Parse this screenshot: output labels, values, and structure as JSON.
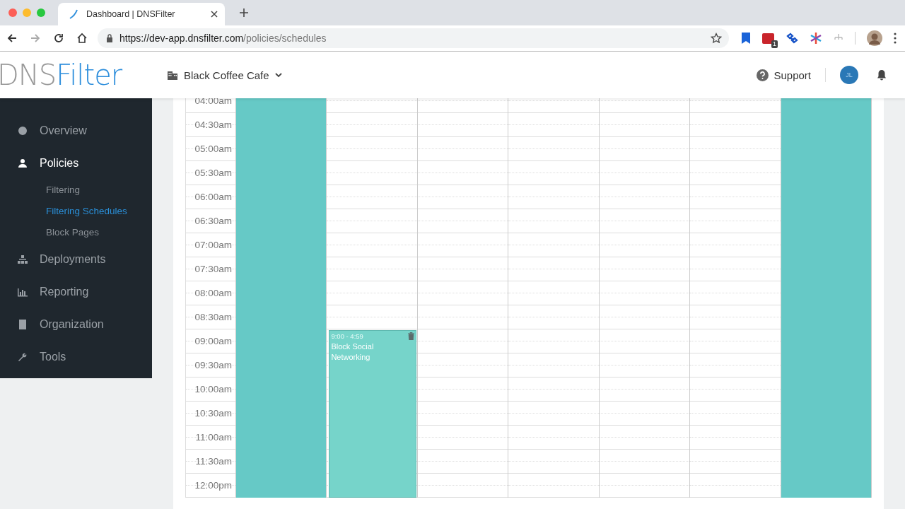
{
  "browser": {
    "tab_title": "Dashboard | DNSFilter",
    "url_host": "https://dev-app.dnsfilter.com",
    "url_path": "/policies/schedules",
    "extension_badge": "1"
  },
  "header": {
    "logo_left": "DNS",
    "logo_right": "Filter",
    "organization": "Black Coffee Cafe",
    "support": "Support",
    "avatar_initials": "JL"
  },
  "sidebar": {
    "items": [
      {
        "label": "Overview",
        "selected": false
      },
      {
        "label": "Policies",
        "selected": true,
        "children": [
          {
            "label": "Filtering",
            "selected": false
          },
          {
            "label": "Filtering Schedules",
            "selected": true
          },
          {
            "label": "Block Pages",
            "selected": false
          }
        ]
      },
      {
        "label": "Deployments",
        "selected": false
      },
      {
        "label": "Reporting",
        "selected": false
      },
      {
        "label": "Organization",
        "selected": false
      },
      {
        "label": "Tools",
        "selected": false
      }
    ]
  },
  "calendar": {
    "times": [
      "04:00am",
      "04:30am",
      "05:00am",
      "05:30am",
      "06:00am",
      "06:30am",
      "07:00am",
      "07:30am",
      "08:00am",
      "08:30am",
      "09:00am",
      "09:30am",
      "10:00am",
      "10:30am",
      "11:00am",
      "11:30am",
      "12:00pm"
    ],
    "days": [
      {
        "all_day": true
      },
      {
        "all_day": false,
        "events": [
          {
            "time": "9:00 - 4:59",
            "title": "Block Social Networking"
          }
        ]
      },
      {
        "all_day": false
      },
      {
        "all_day": false
      },
      {
        "all_day": false
      },
      {
        "all_day": false
      },
      {
        "all_day": true
      }
    ]
  }
}
